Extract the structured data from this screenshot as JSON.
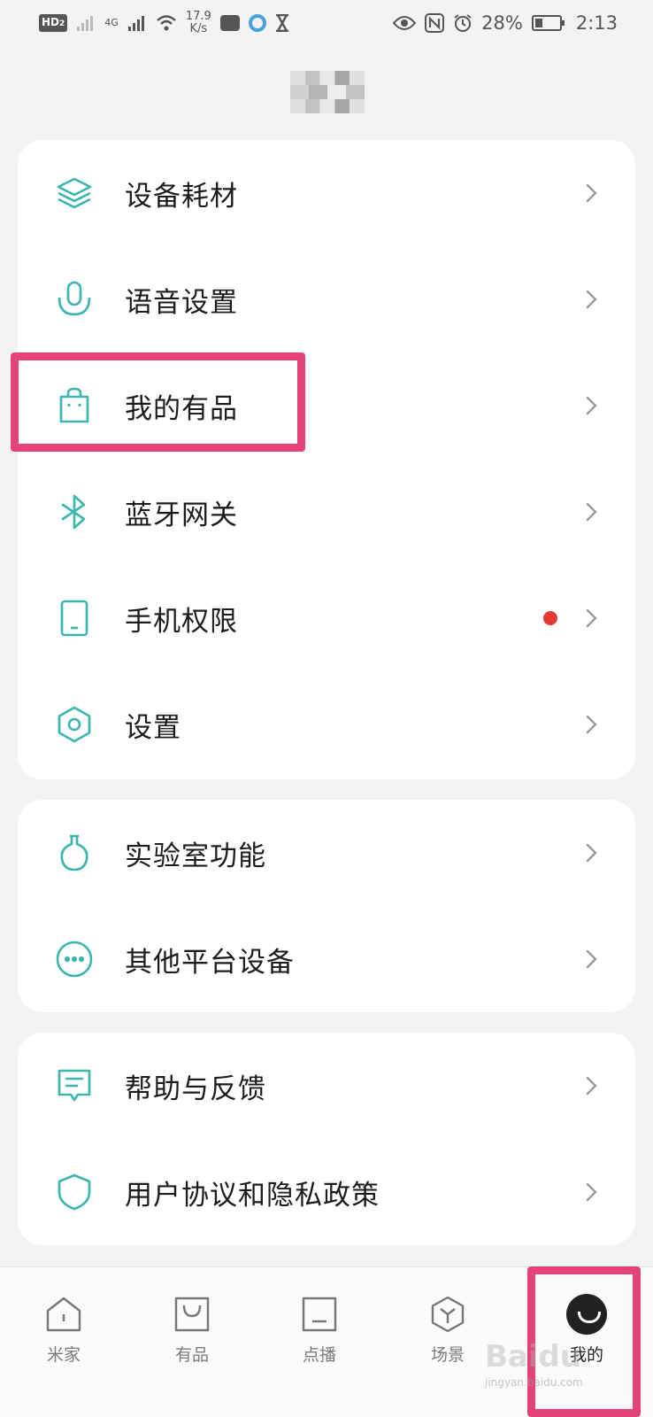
{
  "status_bar": {
    "network_badge": "HD",
    "network_badge_sub": "2",
    "cell_type": "4G",
    "speed_value": "17.9",
    "speed_unit": "K/s",
    "battery_percent": "28%",
    "time": "2:13"
  },
  "colors": {
    "icon_teal": "#3bb5b0",
    "highlight": "#e6427a",
    "notification_dot": "#e53935"
  },
  "menu_groups": [
    {
      "items": [
        {
          "icon": "layers-icon",
          "label": "设备耗材"
        },
        {
          "icon": "microphone-icon",
          "label": "语音设置"
        },
        {
          "icon": "shopping-bag-icon",
          "label": "我的有品"
        },
        {
          "icon": "bluetooth-icon",
          "label": "蓝牙网关"
        },
        {
          "icon": "phone-icon",
          "label": "手机权限"
        },
        {
          "icon": "hexagon-settings-icon",
          "label": "设置"
        }
      ]
    },
    {
      "items": [
        {
          "icon": "flask-icon",
          "label": "实验室功能"
        },
        {
          "icon": "more-dots-icon",
          "label": "其他平台设备"
        }
      ]
    },
    {
      "items": [
        {
          "icon": "feedback-icon",
          "label": "帮助与反馈"
        },
        {
          "icon": "shield-icon",
          "label": "用户协议和隐私政策"
        }
      ]
    }
  ],
  "bottom_nav": [
    {
      "icon": "home-icon",
      "label": "米家"
    },
    {
      "icon": "shop-bag-icon",
      "label": "有品"
    },
    {
      "icon": "tv-icon",
      "label": "点播"
    },
    {
      "icon": "scene-cube-icon",
      "label": "场景"
    },
    {
      "icon": "profile-avatar-icon",
      "label": "我的"
    }
  ],
  "watermark": {
    "text": "Baidu",
    "sub": "jingyan.baidu.com"
  }
}
